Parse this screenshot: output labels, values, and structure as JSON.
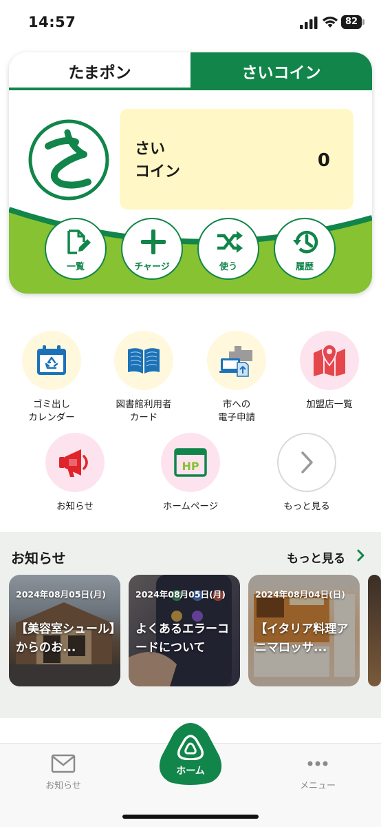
{
  "status_bar": {
    "time": "14:57",
    "battery": "82"
  },
  "coin_card": {
    "tabs": [
      {
        "label": "たまポン",
        "active": false
      },
      {
        "label": "さいコイン",
        "active": true
      }
    ],
    "coin_label": "さい\nコイン",
    "coin_label_line1": "さい",
    "coin_label_line2": "コイン",
    "balance": "0",
    "actions": [
      {
        "label": "一覧",
        "icon": "edit-document-icon"
      },
      {
        "label": "チャージ",
        "icon": "plus-icon"
      },
      {
        "label": "使う",
        "icon": "shuffle-icon"
      },
      {
        "label": "履歴",
        "icon": "history-icon"
      }
    ],
    "colors": {
      "brand_green": "#11854a",
      "light_green": "#86c232",
      "balance_bg": "#fff8c6"
    }
  },
  "services": [
    {
      "line1": "ゴミ出し",
      "line2": "カレンダー",
      "icon": "recycle-calendar-icon"
    },
    {
      "line1": "図書館利用者",
      "line2": "カード",
      "icon": "book-icon"
    },
    {
      "line1": "市への",
      "line2": "電子申請",
      "icon": "e-application-icon"
    },
    {
      "line1": "加盟店一覧",
      "line2": "",
      "icon": "map-pin-icon"
    },
    {
      "line1": "お知らせ",
      "line2": "",
      "icon": "megaphone-icon"
    },
    {
      "line1": "ホームページ",
      "line2": "",
      "icon": "homepage-icon"
    },
    {
      "line1": "もっと見る",
      "line2": "",
      "icon": "chevron-right-icon"
    }
  ],
  "news": {
    "title": "お知らせ",
    "more_label": "もっと見る",
    "items": [
      {
        "date": "2024年08月05日(月)",
        "headline": "【美容室シュール】からのお..."
      },
      {
        "date": "2024年08月05日(月)",
        "headline": "よくあるエラーコードについて"
      },
      {
        "date": "2024年08月04日(日)",
        "headline": "【イタリア料理アニマロッサ..."
      }
    ]
  },
  "tab_bar": {
    "items": [
      {
        "label": "お知らせ",
        "icon": "mail-icon"
      },
      {
        "label": "ホーム",
        "icon": "home-logo-icon",
        "active": true
      },
      {
        "label": "メニュー",
        "icon": "more-dots-icon"
      }
    ]
  }
}
